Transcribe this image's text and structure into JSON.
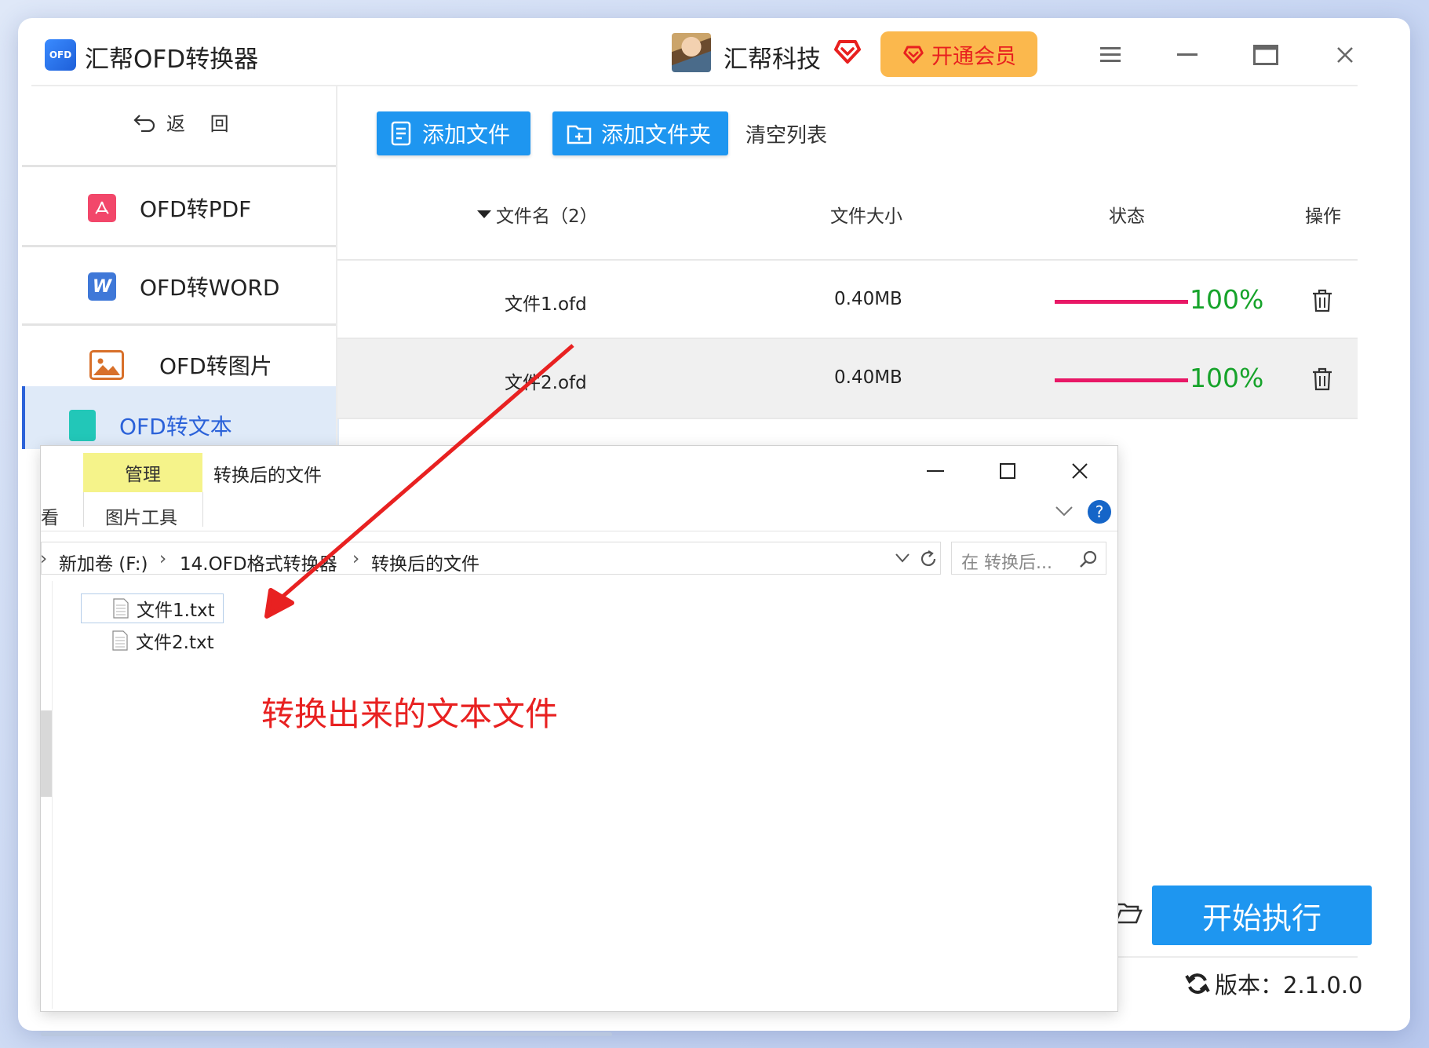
{
  "app": {
    "title": "汇帮OFD转换器",
    "logo_text": "OFD",
    "user_name": "汇帮科技",
    "vip_label": "开通会员"
  },
  "sidebar": {
    "back_label": "返 回",
    "items": [
      {
        "label": "OFD转PDF",
        "icon": "pdf-icon"
      },
      {
        "label": "OFD转WORD",
        "icon": "word-icon"
      },
      {
        "label": "OFD转图片",
        "icon": "image-icon"
      },
      {
        "label": "OFD转文本",
        "icon": "text-icon",
        "active": true
      }
    ]
  },
  "toolbar": {
    "add_file": "添加文件",
    "add_folder": "添加文件夹",
    "clear_list": "清空列表"
  },
  "table": {
    "headers": {
      "name": "文件名（2）",
      "size": "文件大小",
      "status": "状态",
      "action": "操作"
    },
    "rows": [
      {
        "name": "文件1.ofd",
        "size": "0.40MB",
        "progress": 1.0,
        "progress_label": "100%"
      },
      {
        "name": "文件2.ofd",
        "size": "0.40MB",
        "progress": 1.0,
        "progress_label": "100%"
      }
    ]
  },
  "footer": {
    "start_label": "开始执行",
    "version_label": "版本：2.1.0.0"
  },
  "explorer": {
    "ribbon_tab_manage": "管理",
    "ribbon_window_title": "转换后的文件",
    "ribbon_tool": "图片工具",
    "ribbon_view": "看",
    "address": {
      "segments": [
        "新加卷 (F:)",
        "14.OFD格式转换器",
        "转换后的文件"
      ]
    },
    "search_placeholder": "在 转换后...",
    "files": [
      "文件1.txt",
      "文件2.txt"
    ]
  },
  "annotation": {
    "text": "转换出来的文本文件"
  },
  "colors": {
    "accent": "#1e96f0",
    "vip": "#fbb84d",
    "progress": "#e81866",
    "progress_text": "#16a32a",
    "annotation": "#e82121"
  }
}
